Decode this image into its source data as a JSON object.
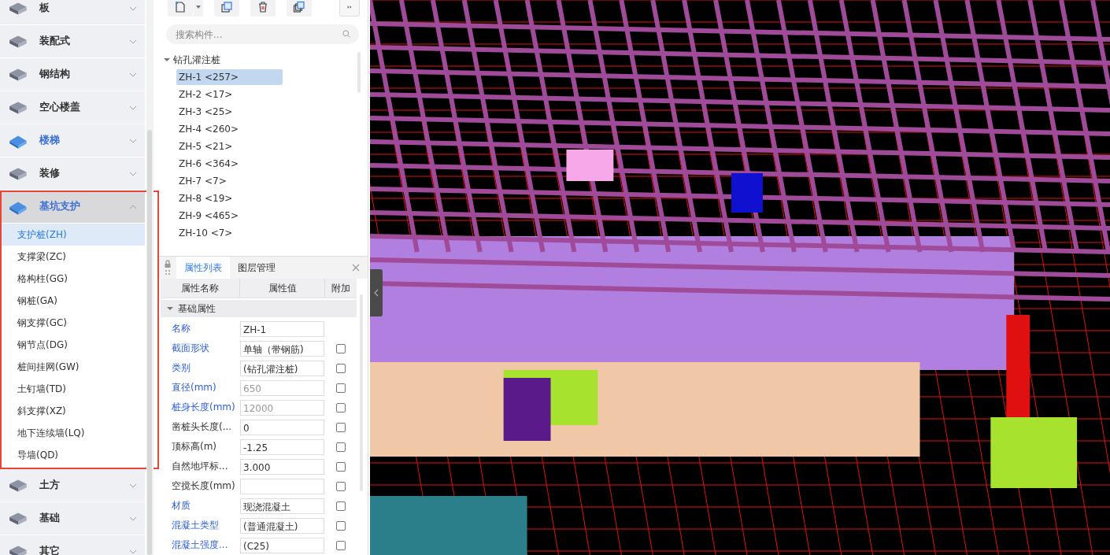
{
  "sidebar": {
    "categories": [
      {
        "label": "板",
        "expanded": false,
        "highlighted": false
      },
      {
        "label": "装配式",
        "expanded": false,
        "highlighted": false
      },
      {
        "label": "钢结构",
        "expanded": false,
        "highlighted": false
      },
      {
        "label": "空心楼盖",
        "expanded": false,
        "highlighted": false
      },
      {
        "label": "楼梯",
        "expanded": false,
        "highlighted": true
      },
      {
        "label": "装修",
        "expanded": false,
        "highlighted": false
      },
      {
        "label": "基坑支护",
        "expanded": true,
        "highlighted": true,
        "items": [
          {
            "label": "支护桩(ZH)",
            "selected": true
          },
          {
            "label": "支撑梁(ZC)",
            "selected": false
          },
          {
            "label": "格构柱(GG)",
            "selected": false
          },
          {
            "label": "钢桩(GA)",
            "selected": false
          },
          {
            "label": "钢支撑(GC)",
            "selected": false
          },
          {
            "label": "钢节点(DG)",
            "selected": false
          },
          {
            "label": "桩间挂网(GW)",
            "selected": false
          },
          {
            "label": "土钉墙(TD)",
            "selected": false
          },
          {
            "label": "斜支撑(XZ)",
            "selected": false
          },
          {
            "label": "地下连续墙(LQ)",
            "selected": false
          },
          {
            "label": "导墙(QD)",
            "selected": false
          }
        ]
      },
      {
        "label": "土方",
        "expanded": false,
        "highlighted": false
      },
      {
        "label": "基础",
        "expanded": false,
        "highlighted": false
      },
      {
        "label": "其它",
        "expanded": false,
        "highlighted": false
      }
    ]
  },
  "component_list": {
    "search": {
      "placeholder": "搜索构件..."
    },
    "tree": {
      "label": "钻孔灌注桩",
      "expanded": true,
      "children": [
        {
          "label": "ZH-1 <257>",
          "selected": true
        },
        {
          "label": "ZH-2 <17>",
          "selected": false
        },
        {
          "label": "ZH-3 <25>",
          "selected": false
        },
        {
          "label": "ZH-4 <260>",
          "selected": false
        },
        {
          "label": "ZH-5 <21>",
          "selected": false
        },
        {
          "label": "ZH-6 <364>",
          "selected": false
        },
        {
          "label": "ZH-7 <7>",
          "selected": false
        },
        {
          "label": "ZH-8 <19>",
          "selected": false
        },
        {
          "label": "ZH-9 <465>",
          "selected": false
        },
        {
          "label": "ZH-10 <7>",
          "selected": false
        }
      ]
    }
  },
  "properties": {
    "tabs": [
      {
        "label": "属性列表",
        "selected": true
      },
      {
        "label": "图层管理",
        "selected": false
      }
    ],
    "columns": [
      "属性名称",
      "属性值",
      "附加"
    ],
    "group": {
      "label": "基础属性",
      "expanded": true
    },
    "rows": [
      {
        "name": "名称",
        "value": "ZH-1",
        "public": true,
        "disabled": false,
        "kind": "plain"
      },
      {
        "name": "截面形状",
        "value": "单轴（带钢筋)",
        "public": true,
        "disabled": false,
        "kind": "extra",
        "checked": false
      },
      {
        "name": "类别",
        "value": "(钻孔灌注桩)",
        "public": true,
        "disabled": false,
        "kind": "extra",
        "checked": false
      },
      {
        "name": "直径(mm)",
        "value": "650",
        "public": true,
        "disabled": true,
        "kind": "extra",
        "checked": false
      },
      {
        "name": "桩身长度(mm)",
        "value": "12000",
        "public": true,
        "disabled": true,
        "kind": "extra",
        "checked": false
      },
      {
        "name": "凿桩头长度(...",
        "value": "0",
        "public": false,
        "disabled": false,
        "kind": "extra",
        "checked": false
      },
      {
        "name": "顶标高(m)",
        "value": "-1.25",
        "public": false,
        "disabled": false,
        "kind": "extra",
        "checked": false
      },
      {
        "name": "自然地坪标...",
        "value": "3.000",
        "public": false,
        "disabled": false,
        "kind": "extra",
        "checked": false
      },
      {
        "name": "空搅长度(mm)",
        "value": "",
        "public": false,
        "disabled": false,
        "kind": "extra",
        "checked": false
      },
      {
        "name": "材质",
        "value": "现浇混凝土",
        "public": true,
        "disabled": false,
        "kind": "extra",
        "checked": false
      },
      {
        "name": "混凝土类型",
        "value": "(普通混凝土)",
        "public": true,
        "disabled": false,
        "kind": "extra",
        "checked": false
      },
      {
        "name": "混凝土强度...",
        "value": "(C25)",
        "public": true,
        "disabled": false,
        "kind": "extra",
        "checked": false
      }
    ]
  }
}
